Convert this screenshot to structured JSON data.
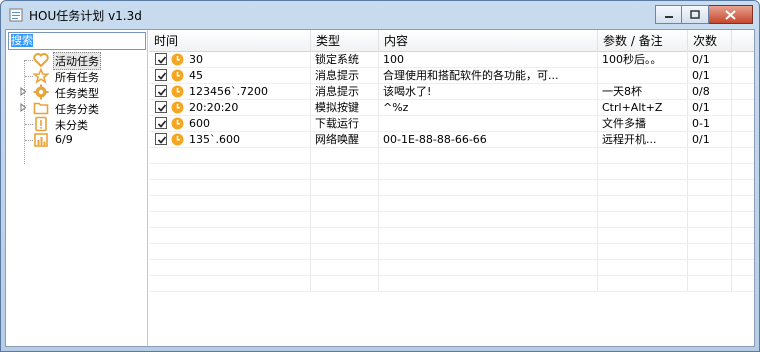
{
  "window": {
    "title": "HOU任务计划 v1.3d"
  },
  "search": {
    "value": "搜索"
  },
  "tree": [
    {
      "label": "活动任务",
      "icon": "heart-icon",
      "selected": true
    },
    {
      "label": "所有任务",
      "icon": "star-icon"
    },
    {
      "label": "任务类型",
      "icon": "gear-icon",
      "expandable": true
    },
    {
      "label": "任务分类",
      "icon": "folder-icon",
      "expandable": true
    },
    {
      "label": "未分类",
      "icon": "exclamation-icon"
    },
    {
      "label": "6/9",
      "icon": "chart-icon"
    }
  ],
  "columns": [
    "时间",
    "类型",
    "内容",
    "参数 / 备注",
    "次数"
  ],
  "rows": [
    {
      "checked": true,
      "time": "30",
      "type": "锁定系统",
      "content": "100",
      "param": "100秒后。。",
      "count": "0/1"
    },
    {
      "checked": true,
      "time": "45",
      "type": "消息提示",
      "content": "合理使用和搭配软件的各功能，可...",
      "param": "",
      "count": "0/1"
    },
    {
      "checked": true,
      "time": "123456`.7200",
      "type": "消息提示",
      "content": "该喝水了!",
      "param": "一天8杯",
      "count": "0/8"
    },
    {
      "checked": true,
      "time": "20:20:20",
      "type": "模拟按键",
      "content": "^%z",
      "param": "Ctrl+Alt+Z",
      "count": "0/1"
    },
    {
      "checked": true,
      "time": "600",
      "type": "下载运行",
      "content": "",
      "param": "文件多播",
      "count": "0-1"
    },
    {
      "checked": true,
      "time": "135`.600",
      "type": "网络唤醒",
      "content": "00-1E-88-88-66-66",
      "param": "远程开机...",
      "count": "0/1"
    }
  ],
  "empty_rows": 9,
  "colors": {
    "accent": "#3399ff",
    "clock": "#f5a623",
    "heart": "#e8a33a"
  }
}
